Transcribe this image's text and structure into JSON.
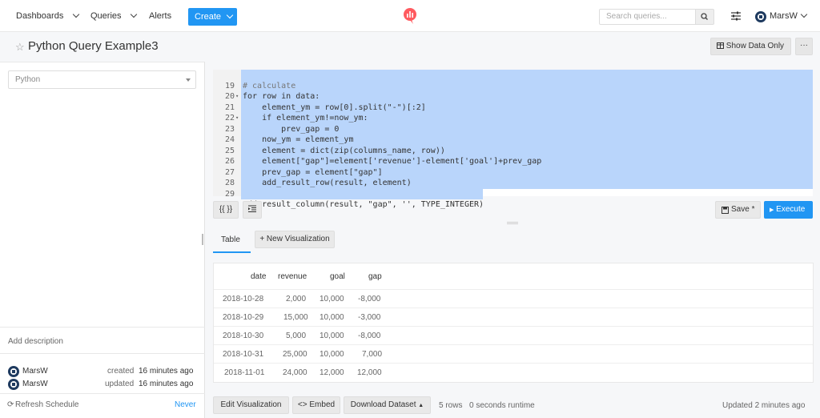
{
  "nav": {
    "dashboards": "Dashboards",
    "queries": "Queries",
    "alerts": "Alerts",
    "create": "Create",
    "search_placeholder": "Search queries...",
    "user": "MarsW",
    "brand_color": "#ff5a5f",
    "accent_color": "#2196f3"
  },
  "header": {
    "title": "Python Query Example3",
    "show_data_only": "Show Data Only",
    "more": "···"
  },
  "sidebar": {
    "datasource": "Python",
    "add_description": "Add description",
    "created_by": "MarsW",
    "created_label": "created",
    "created_time": "16 minutes ago",
    "updated_by": "MarsW",
    "updated_label": "updated",
    "updated_time": "16 minutes ago",
    "refresh_label": "Refresh Schedule",
    "refresh_value": "Never"
  },
  "editor": {
    "lines": [
      {
        "n": "19",
        "fold": "",
        "code": "# calculate"
      },
      {
        "n": "20",
        "fold": "▾",
        "code": "for row in data:"
      },
      {
        "n": "21",
        "fold": "",
        "code": "    element_ym = row[0].split(\"-\")[:2]"
      },
      {
        "n": "22",
        "fold": "▾",
        "code": "    if element_ym!=now_ym:"
      },
      {
        "n": "23",
        "fold": "",
        "code": "        prev_gap = 0"
      },
      {
        "n": "24",
        "fold": "",
        "code": "    now_ym = element_ym"
      },
      {
        "n": "25",
        "fold": "",
        "code": "    element = dict(zip(columns_name, row))"
      },
      {
        "n": "26",
        "fold": "",
        "code": "    element[\"gap\"]=element['revenue']-element['goal']+prev_gap"
      },
      {
        "n": "27",
        "fold": "",
        "code": "    prev_gap = element[\"gap\"]"
      },
      {
        "n": "28",
        "fold": "",
        "code": "    add_result_row(result, element)"
      },
      {
        "n": "29",
        "fold": "",
        "code": ""
      },
      {
        "n": "30",
        "fold": "",
        "code": "add_result_column(result, \"gap\", '', TYPE_INTEGER)"
      }
    ],
    "format_btn": "{{ }}",
    "save": "Save *",
    "execute": "Execute"
  },
  "tabs": {
    "table": "Table",
    "new_viz": "+ New Visualization"
  },
  "results": {
    "columns": [
      "date",
      "revenue",
      "goal",
      "gap"
    ],
    "rows": [
      [
        "2018-10-28",
        "2,000",
        "10,000",
        "-8,000"
      ],
      [
        "2018-10-29",
        "15,000",
        "10,000",
        "-3,000"
      ],
      [
        "2018-10-30",
        "5,000",
        "10,000",
        "-8,000"
      ],
      [
        "2018-10-31",
        "25,000",
        "10,000",
        "7,000"
      ],
      [
        "2018-11-01",
        "24,000",
        "12,000",
        "12,000"
      ]
    ]
  },
  "footer": {
    "edit_viz": "Edit Visualization",
    "embed": "Embed",
    "download": "Download Dataset",
    "rows": "5 rows",
    "runtime": "0 seconds runtime",
    "updated": "Updated 2 minutes ago"
  }
}
